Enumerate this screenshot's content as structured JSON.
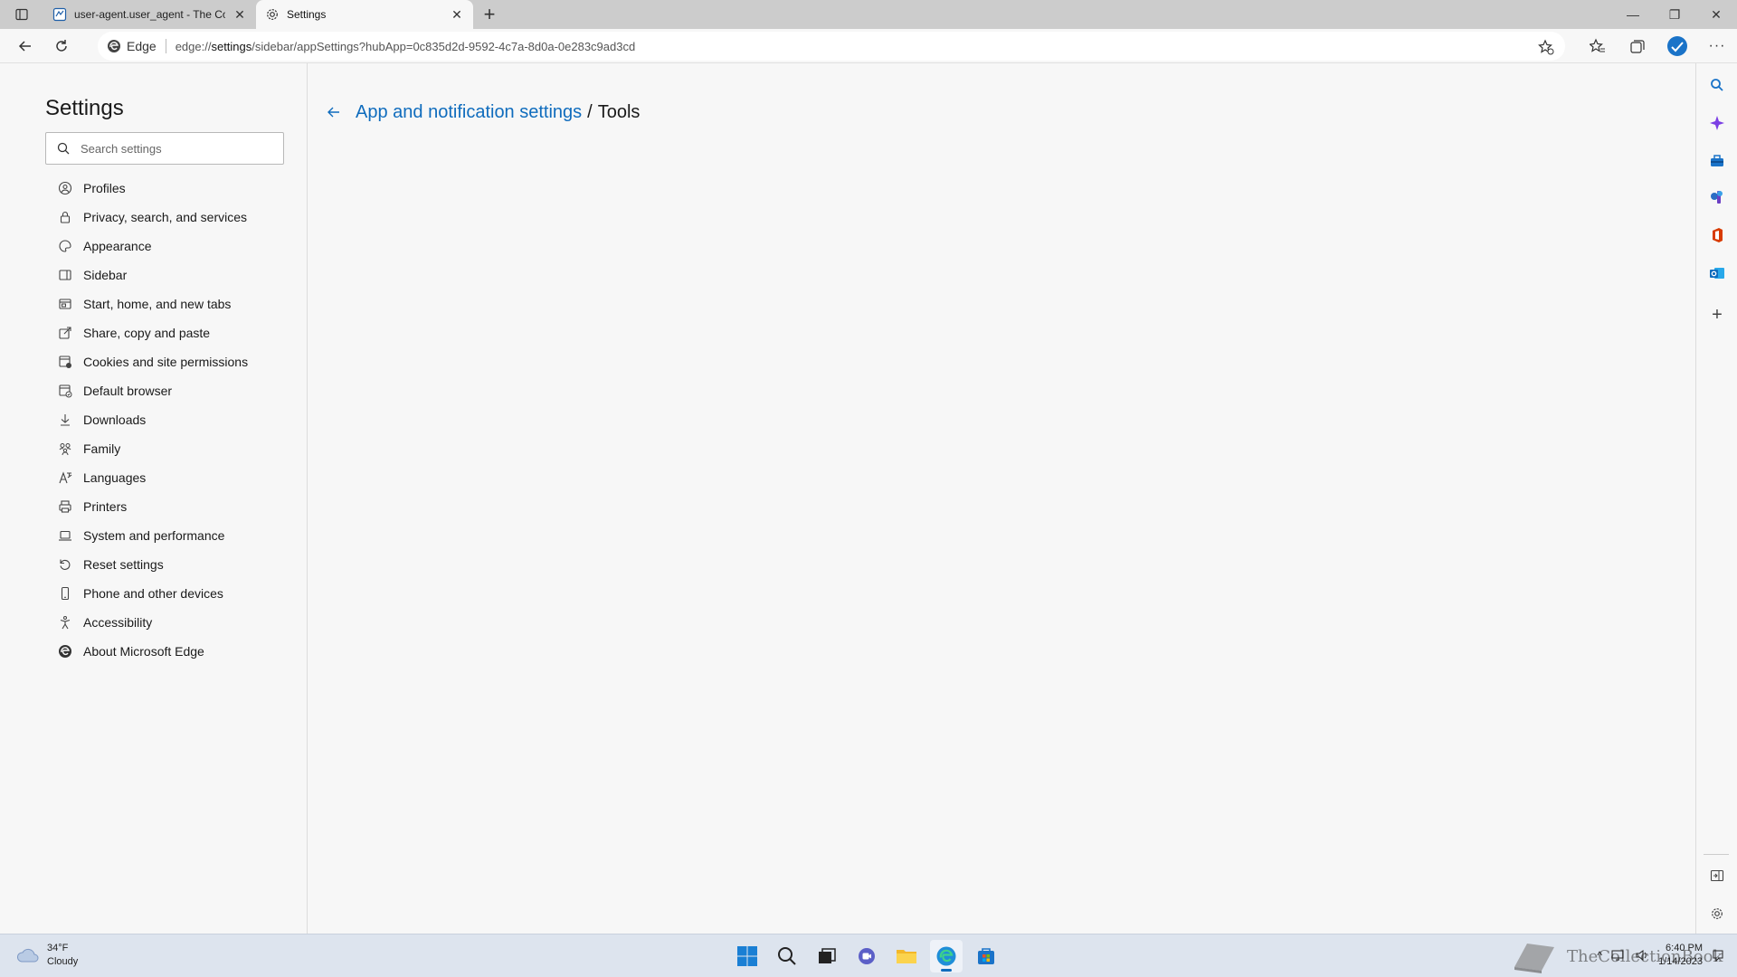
{
  "tabs": [
    {
      "title": "user-agent.user_agent - The Coll",
      "icon": "document-globe-icon",
      "active": false
    },
    {
      "title": "Settings",
      "icon": "gear-icon",
      "active": true
    }
  ],
  "address": {
    "site_label": "Edge",
    "url_prefix": "edge://",
    "url_main": "settings",
    "url_rest": "/sidebar/appSettings?hubApp=0c835d2d-9592-4c7a-8d0a-0e283c9ad3cd"
  },
  "settings": {
    "title": "Settings",
    "search_placeholder": "Search settings",
    "nav": [
      {
        "label": "Profiles",
        "icon": "profile-icon"
      },
      {
        "label": "Privacy, search, and services",
        "icon": "lock-icon"
      },
      {
        "label": "Appearance",
        "icon": "palette-icon"
      },
      {
        "label": "Sidebar",
        "icon": "sidebar-icon"
      },
      {
        "label": "Start, home, and new tabs",
        "icon": "home-tabs-icon"
      },
      {
        "label": "Share, copy and paste",
        "icon": "share-icon"
      },
      {
        "label": "Cookies and site permissions",
        "icon": "cookies-icon"
      },
      {
        "label": "Default browser",
        "icon": "browser-icon"
      },
      {
        "label": "Downloads",
        "icon": "download-icon"
      },
      {
        "label": "Family",
        "icon": "family-icon"
      },
      {
        "label": "Languages",
        "icon": "languages-icon"
      },
      {
        "label": "Printers",
        "icon": "printer-icon"
      },
      {
        "label": "System and performance",
        "icon": "laptop-icon"
      },
      {
        "label": "Reset settings",
        "icon": "reset-icon"
      },
      {
        "label": "Phone and other devices",
        "icon": "phone-icon"
      },
      {
        "label": "Accessibility",
        "icon": "accessibility-icon"
      },
      {
        "label": "About Microsoft Edge",
        "icon": "edge-icon"
      }
    ]
  },
  "breadcrumb": {
    "parent": "App and notification settings",
    "separator": "/",
    "current": "Tools"
  },
  "taskbar": {
    "weather_temp": "34°F",
    "weather_desc": "Cloudy",
    "time": "6:40 PM",
    "date": "1/14/2023",
    "watermark": "TheCollectionBook"
  },
  "colors": {
    "accent": "#0f6cbd",
    "tabstrip": "#cccccc",
    "background": "#f7f7f7"
  }
}
